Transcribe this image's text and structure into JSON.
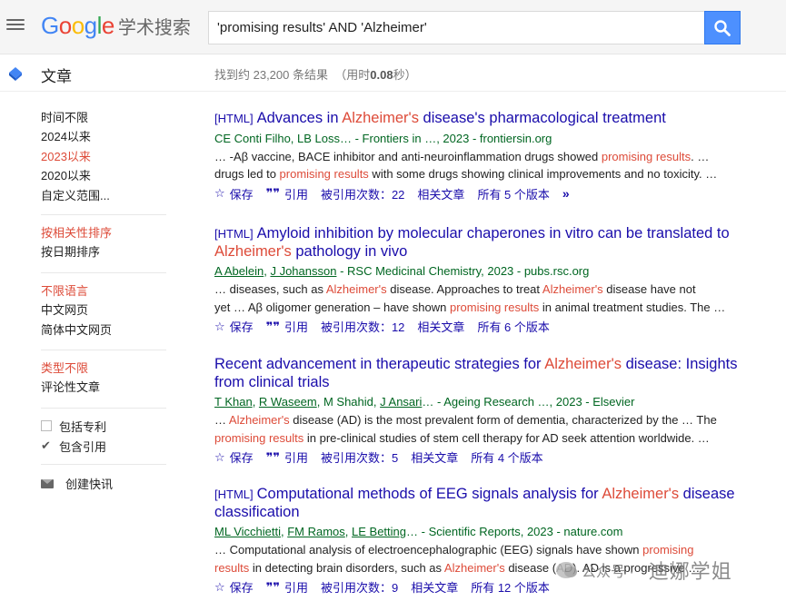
{
  "header": {
    "logo_google": "Google",
    "logo_suffix": "学术搜索",
    "search_query": "'promising results' AND 'Alzheimer'",
    "colors": {
      "blue": "#4285f4",
      "red": "#ea4335",
      "yellow": "#fbbc05",
      "green": "#34a853",
      "search_button": "#4d90fe"
    }
  },
  "subheader": {
    "section_title": "文章",
    "stats_prefix": "找到约 23,200 条结果",
    "stats_time_prefix": "（用时",
    "stats_time": "0.08",
    "stats_time_suffix": "秒）"
  },
  "sidebar": {
    "time_filters": [
      "时间不限",
      "2024以来",
      "2023以来",
      "2020以来",
      "自定义范围..."
    ],
    "sort_options": [
      "按相关性排序",
      "按日期排序"
    ],
    "language_options": [
      "不限语言",
      "中文网页",
      "简体中文网页"
    ],
    "type_options": [
      "类型不限",
      "评论性文章"
    ],
    "include_patents": "包括专利",
    "include_citations": "包含引用",
    "create_alert": "创建快讯"
  },
  "results": [
    {
      "tag": "[HTML]",
      "title_parts": [
        "Advances in ",
        "Alzheimer's",
        " disease's pharmacological treatment"
      ],
      "title_line2_parts": [],
      "meta": "CE Conti Filho, LB Loss… - Frontiers in …, 2023 - frontiersin.org",
      "snippet1_parts": [
        "… -Aβ vaccine, BACE inhibitor and anti-neuroinflammation drugs showed ",
        "promising results",
        ". …"
      ],
      "snippet2_parts": [
        "drugs led to ",
        "promising results",
        " with some drugs showing clinical improvements and no toxicity. …"
      ],
      "save": "保存",
      "cite": "引用",
      "cited_by": "被引用次数：22",
      "related": "相关文章",
      "versions": "所有 5 个版本"
    },
    {
      "tag": "[HTML]",
      "title_parts": [
        "Amyloid inhibition by molecular chaperones in vitro can be translated to"
      ],
      "title_line2_parts": [
        "Alzheimer's",
        " pathology in vivo"
      ],
      "meta_authors": [
        "A Abelein",
        "J Johansson"
      ],
      "meta_rest": " - RSC Medicinal Chemistry, 2023 - pubs.rsc.org",
      "snippet1_parts": [
        "… diseases, such as ",
        "Alzheimer's",
        " disease. Approaches to treat ",
        "Alzheimer's",
        " disease have not"
      ],
      "snippet2_parts": [
        "yet … Aβ oligomer generation – have shown ",
        "promising results",
        " in animal treatment studies. The …"
      ],
      "save": "保存",
      "cite": "引用",
      "cited_by": "被引用次数：12",
      "related": "相关文章",
      "versions": "所有 6 个版本"
    },
    {
      "tag": "",
      "title_parts": [
        "Recent advancement in therapeutic strategies for ",
        "Alzheimer's",
        " disease: Insights"
      ],
      "title_line2_parts": [
        "from clinical trials"
      ],
      "meta_authors": [
        "T Khan",
        "R Waseem",
        "M Shahid",
        "J Ansari"
      ],
      "meta_rest": "… - Ageing Research …, 2023 - Elsevier",
      "snippet1_parts": [
        "… ",
        "Alzheimer's",
        " disease (AD) is the most prevalent form of dementia, characterized by the … The"
      ],
      "snippet2_parts": [
        "promising results",
        " in pre-clinical studies of stem cell therapy for AD seek attention worldwide. …"
      ],
      "save": "保存",
      "cite": "引用",
      "cited_by": "被引用次数：5",
      "related": "相关文章",
      "versions": "所有 4 个版本"
    },
    {
      "tag": "[HTML]",
      "title_parts": [
        "Computational methods of EEG signals analysis for ",
        "Alzheimer's",
        " disease"
      ],
      "title_line2_parts": [
        "classification"
      ],
      "meta_authors": [
        "ML Vicchietti",
        "FM Ramos",
        "LE Betting"
      ],
      "meta_rest": "… - Scientific Reports, 2023 - nature.com",
      "snippet1_parts": [
        "… Computational analysis of electroencephalographic (EEG) signals have shown ",
        "promising"
      ],
      "snippet2_parts": [
        "results",
        " in detecting brain disorders, such as ",
        "Alzheimer's",
        " disease (AD). AD is a progressive …"
      ],
      "save": "保存",
      "cite": "引用",
      "cited_by": "被引用次数：9",
      "related": "相关文章",
      "versions": "所有 12 个版本"
    }
  ],
  "watermark": {
    "text1": "公众号 ·",
    "text2": "迪娜学姐"
  }
}
